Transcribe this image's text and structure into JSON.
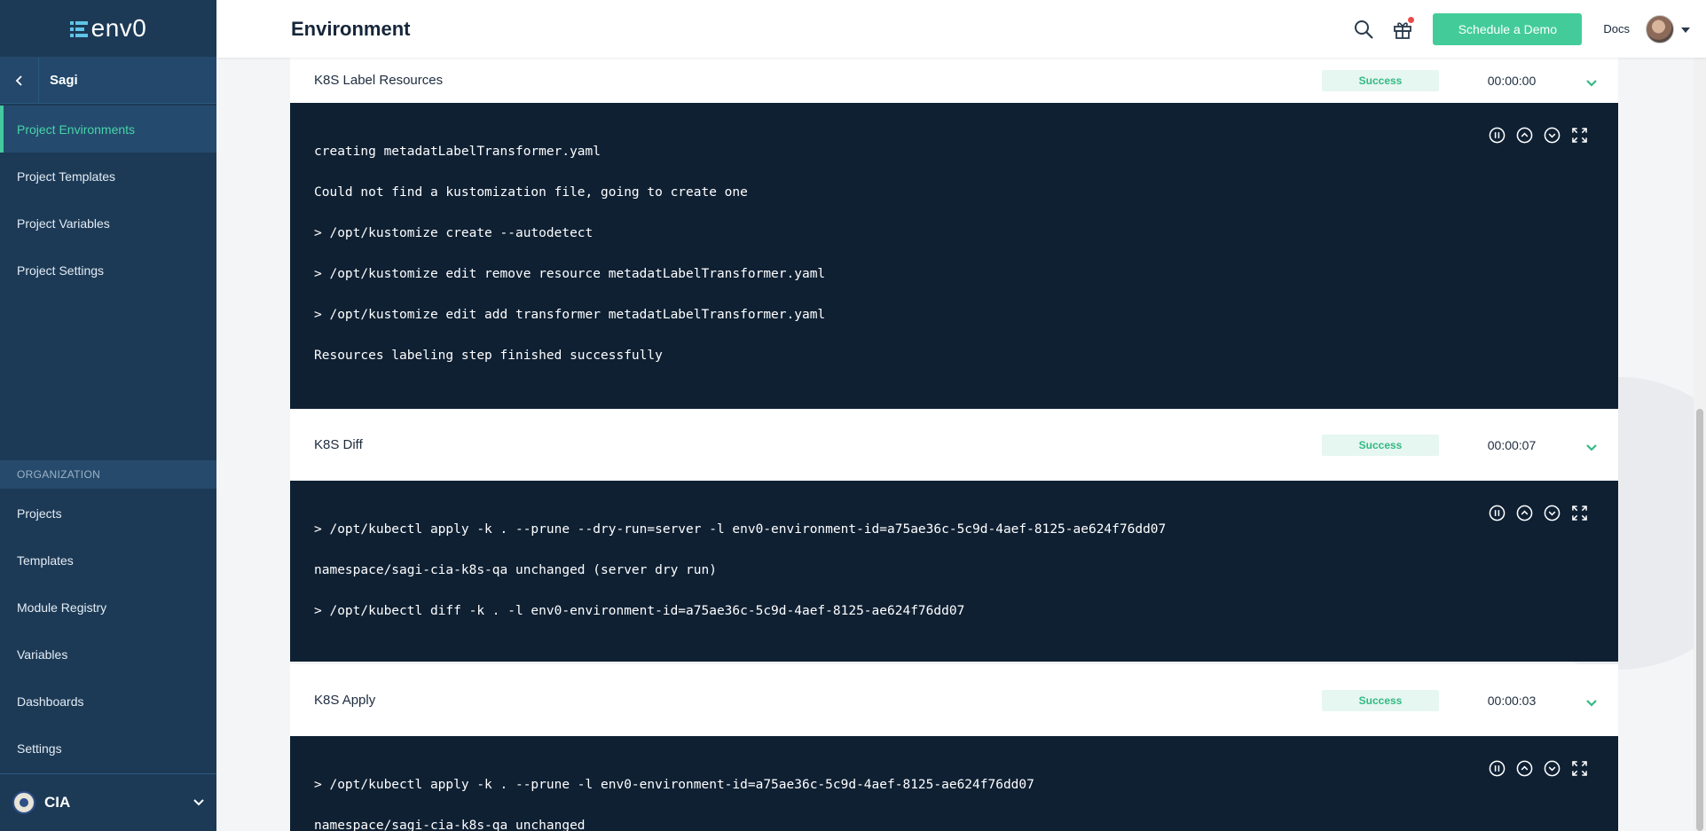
{
  "app": {
    "logo_text": "env0",
    "brand_color": "#43cc99",
    "sidebar_color": "#1c3a56",
    "terminal_color": "#0f2033"
  },
  "sidebar": {
    "back_label": "Sagi",
    "project_items": [
      {
        "label": "Project Environments",
        "active": true
      },
      {
        "label": "Project Templates",
        "active": false
      },
      {
        "label": "Project Variables",
        "active": false
      },
      {
        "label": "Project Settings",
        "active": false
      }
    ],
    "org_header": "ORGANIZATION",
    "org_items": [
      {
        "label": "Projects"
      },
      {
        "label": "Templates"
      },
      {
        "label": "Module Registry"
      },
      {
        "label": "Variables"
      },
      {
        "label": "Dashboards"
      },
      {
        "label": "Settings"
      }
    ],
    "org_name": "CIA"
  },
  "header": {
    "title": "Environment",
    "demo_button": "Schedule a Demo",
    "docs_link": "Docs",
    "icons": [
      "search-icon",
      "gift-icon",
      "avatar",
      "caret-down-icon"
    ]
  },
  "steps": [
    {
      "name": "K8S Label Resources",
      "status": "Success",
      "duration": "00:00:00",
      "log_lines": [
        "creating metadatLabelTransformer.yaml",
        "Could not find a kustomization file, going to create one",
        "> /opt/kustomize create --autodetect",
        "> /opt/kustomize edit remove resource metadatLabelTransformer.yaml",
        "> /opt/kustomize edit add transformer metadatLabelTransformer.yaml",
        "Resources labeling step finished successfully"
      ]
    },
    {
      "name": "K8S Diff",
      "status": "Success",
      "duration": "00:00:07",
      "log_lines": [
        "> /opt/kubectl apply -k . --prune --dry-run=server -l env0-environment-id=a75ae36c-5c9d-4aef-8125-ae624f76dd07",
        "namespace/sagi-cia-k8s-qa unchanged (server dry run)",
        "> /opt/kubectl diff -k . -l env0-environment-id=a75ae36c-5c9d-4aef-8125-ae624f76dd07"
      ]
    },
    {
      "name": "K8S Apply",
      "status": "Success",
      "duration": "00:00:03",
      "log_lines": [
        "> /opt/kubectl apply -k . --prune -l env0-environment-id=a75ae36c-5c9d-4aef-8125-ae624f76dd07",
        "namespace/sagi-cia-k8s-qa unchanged"
      ]
    }
  ],
  "log_tools": [
    "pause-icon",
    "scroll-up-icon",
    "scroll-down-icon",
    "fullscreen-icon"
  ]
}
